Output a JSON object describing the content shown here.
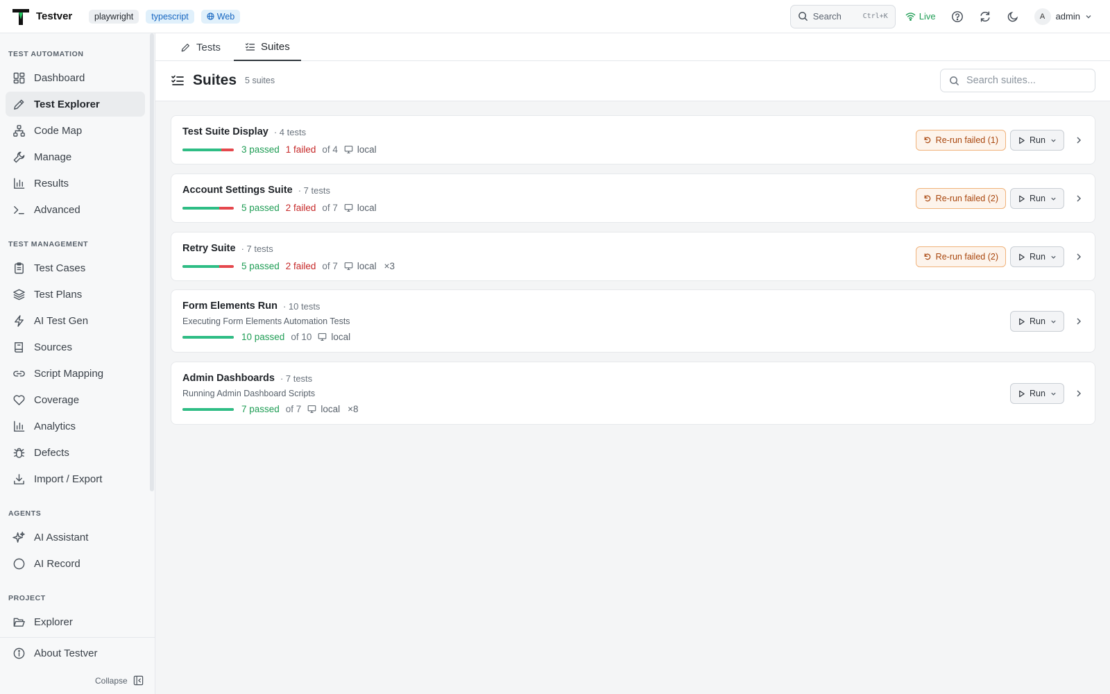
{
  "app": {
    "name": "Testver",
    "tags": [
      "playwright",
      "typescript",
      "Web"
    ]
  },
  "header": {
    "search_label": "Search",
    "search_shortcut": "Ctrl+K",
    "live_label": "Live",
    "user_initial": "A",
    "user_name": "admin"
  },
  "sidebar": {
    "sections": [
      {
        "title": "TEST AUTOMATION",
        "items": [
          {
            "label": "Dashboard",
            "icon": "dashboard-icon"
          },
          {
            "label": "Test Explorer",
            "icon": "pencil-icon",
            "active": true
          },
          {
            "label": "Code Map",
            "icon": "sitemap-icon"
          },
          {
            "label": "Manage",
            "icon": "wrench-icon"
          },
          {
            "label": "Results",
            "icon": "bar-chart-icon"
          },
          {
            "label": "Advanced",
            "icon": "terminal-icon"
          }
        ]
      },
      {
        "title": "TEST MANAGEMENT",
        "items": [
          {
            "label": "Test Cases",
            "icon": "clipboard-icon"
          },
          {
            "label": "Test Plans",
            "icon": "layers-icon"
          },
          {
            "label": "AI Test Gen",
            "icon": "lightning-icon"
          },
          {
            "label": "Sources",
            "icon": "book-icon"
          },
          {
            "label": "Script Mapping",
            "icon": "link-icon"
          },
          {
            "label": "Coverage",
            "icon": "heart-icon"
          },
          {
            "label": "Analytics",
            "icon": "bar-chart-icon"
          },
          {
            "label": "Defects",
            "icon": "bug-icon"
          },
          {
            "label": "Import / Export",
            "icon": "download-icon"
          }
        ]
      },
      {
        "title": "AGENTS",
        "items": [
          {
            "label": "AI Assistant",
            "icon": "sparkles-icon"
          },
          {
            "label": "AI Record",
            "icon": "circle-icon"
          }
        ]
      },
      {
        "title": "PROJECT",
        "items": [
          {
            "label": "Explorer",
            "icon": "folder-icon"
          }
        ]
      }
    ],
    "about_label": "About Testver",
    "collapse_label": "Collapse"
  },
  "tabs": [
    {
      "label": "Tests",
      "active": false
    },
    {
      "label": "Suites",
      "active": true
    }
  ],
  "page": {
    "title": "Suites",
    "count": "5 suites",
    "search_placeholder": "Search suites..."
  },
  "suites": [
    {
      "name": "Test Suite Display",
      "tests": "· 4 tests",
      "desc": "",
      "pass_fraction": 0.75,
      "passed": "3 passed",
      "failed": "1 failed",
      "of": "of 4",
      "env": "local",
      "mult": "",
      "rerun": "Re-run failed (1)",
      "run": "Run"
    },
    {
      "name": "Account Settings Suite",
      "tests": "· 7 tests",
      "desc": "",
      "pass_fraction": 0.714,
      "passed": "5 passed",
      "failed": "2 failed",
      "of": "of 7",
      "env": "local",
      "mult": "",
      "rerun": "Re-run failed (2)",
      "run": "Run"
    },
    {
      "name": "Retry Suite",
      "tests": "· 7 tests",
      "desc": "",
      "pass_fraction": 0.714,
      "passed": "5 passed",
      "failed": "2 failed",
      "of": "of 7",
      "env": "local",
      "mult": "×3",
      "rerun": "Re-run failed (2)",
      "run": "Run"
    },
    {
      "name": "Form Elements Run",
      "tests": "· 10 tests",
      "desc": "Executing Form Elements Automation Tests",
      "pass_fraction": 1.0,
      "passed": "10 passed",
      "failed": "",
      "of": "of 10",
      "env": "local",
      "mult": "",
      "rerun": "",
      "run": "Run"
    },
    {
      "name": "Admin Dashboards",
      "tests": "· 7 tests",
      "desc": "Running Admin Dashboard Scripts",
      "pass_fraction": 1.0,
      "passed": "7 passed",
      "failed": "",
      "of": "of 7",
      "env": "local",
      "mult": "×8",
      "rerun": "",
      "run": "Run"
    }
  ],
  "colors": {
    "passed": "#1f9d55",
    "failed": "#c62828",
    "bar_pass": "#2ebd85",
    "bar_fail": "#e5484d",
    "rerun_bg": "#fdf4ec",
    "rerun_text": "#a8450c"
  }
}
